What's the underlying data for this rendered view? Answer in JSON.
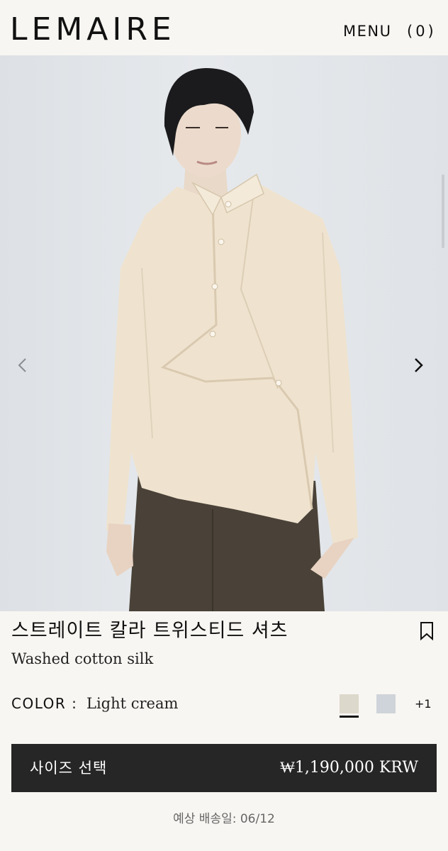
{
  "header": {
    "logo": "LEMAIRE",
    "menu_label": "MENU",
    "cart_label": "(0)"
  },
  "gallery": {
    "image_subject": "model wearing light cream twisted collar shirt",
    "prev_icon": "chevron-left-icon",
    "next_icon": "chevron-right-icon"
  },
  "product": {
    "title": "스트레이트 칼라 트위스티드 셔츠",
    "material": "Washed cotton silk",
    "bookmark_icon": "bookmark-icon"
  },
  "color": {
    "label": "COLOR :",
    "selected": "Light cream",
    "swatches": [
      {
        "name": "Light cream",
        "hex": "#dcd8cb"
      },
      {
        "name": "Light blue-grey",
        "hex": "#cfd4da"
      }
    ],
    "more": "+1"
  },
  "purchase": {
    "select_size_label": "사이즈 선택",
    "price": "₩1,190,000 KRW"
  },
  "delivery": {
    "text": "예상 배송일: 06/12"
  },
  "colors": {
    "background": "#f8f6f2",
    "button_bg": "#262626",
    "shirt": "#efe3cf"
  }
}
